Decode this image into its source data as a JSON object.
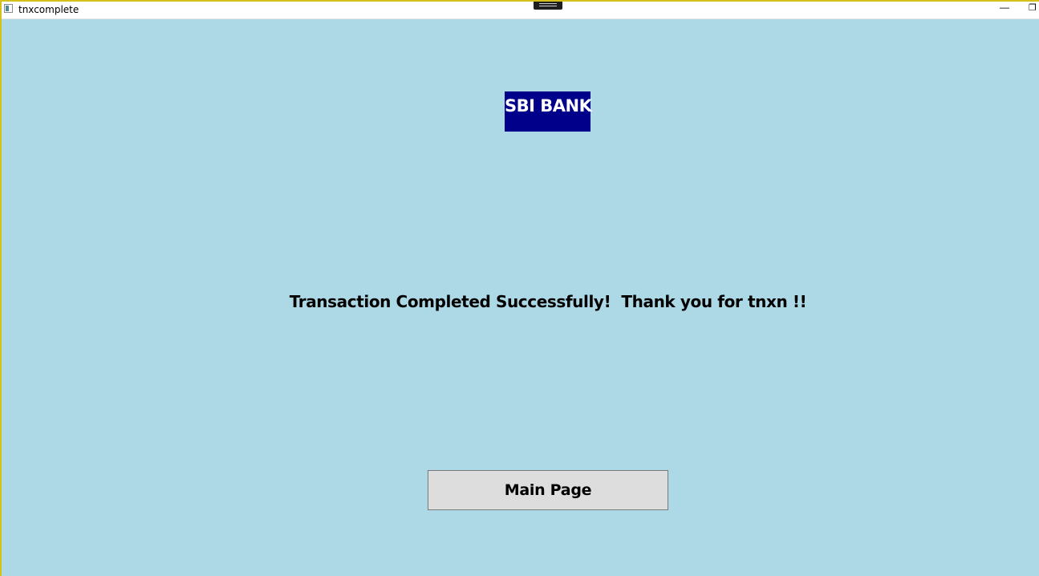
{
  "window": {
    "title": "tnxcomplete",
    "minimize_glyph": "—",
    "restore_glyph": "❐",
    "app_icon": "window-app-icon"
  },
  "logo": {
    "text": "SBI BANK",
    "background": "#00008b",
    "color": "#ffffff"
  },
  "message": {
    "text": "Transaction Completed Successfully!  Thank you for tnxn !!"
  },
  "actions": {
    "main_page_label": "Main Page"
  },
  "colors": {
    "background": "#add8e6",
    "button_bg": "#dddddd"
  }
}
